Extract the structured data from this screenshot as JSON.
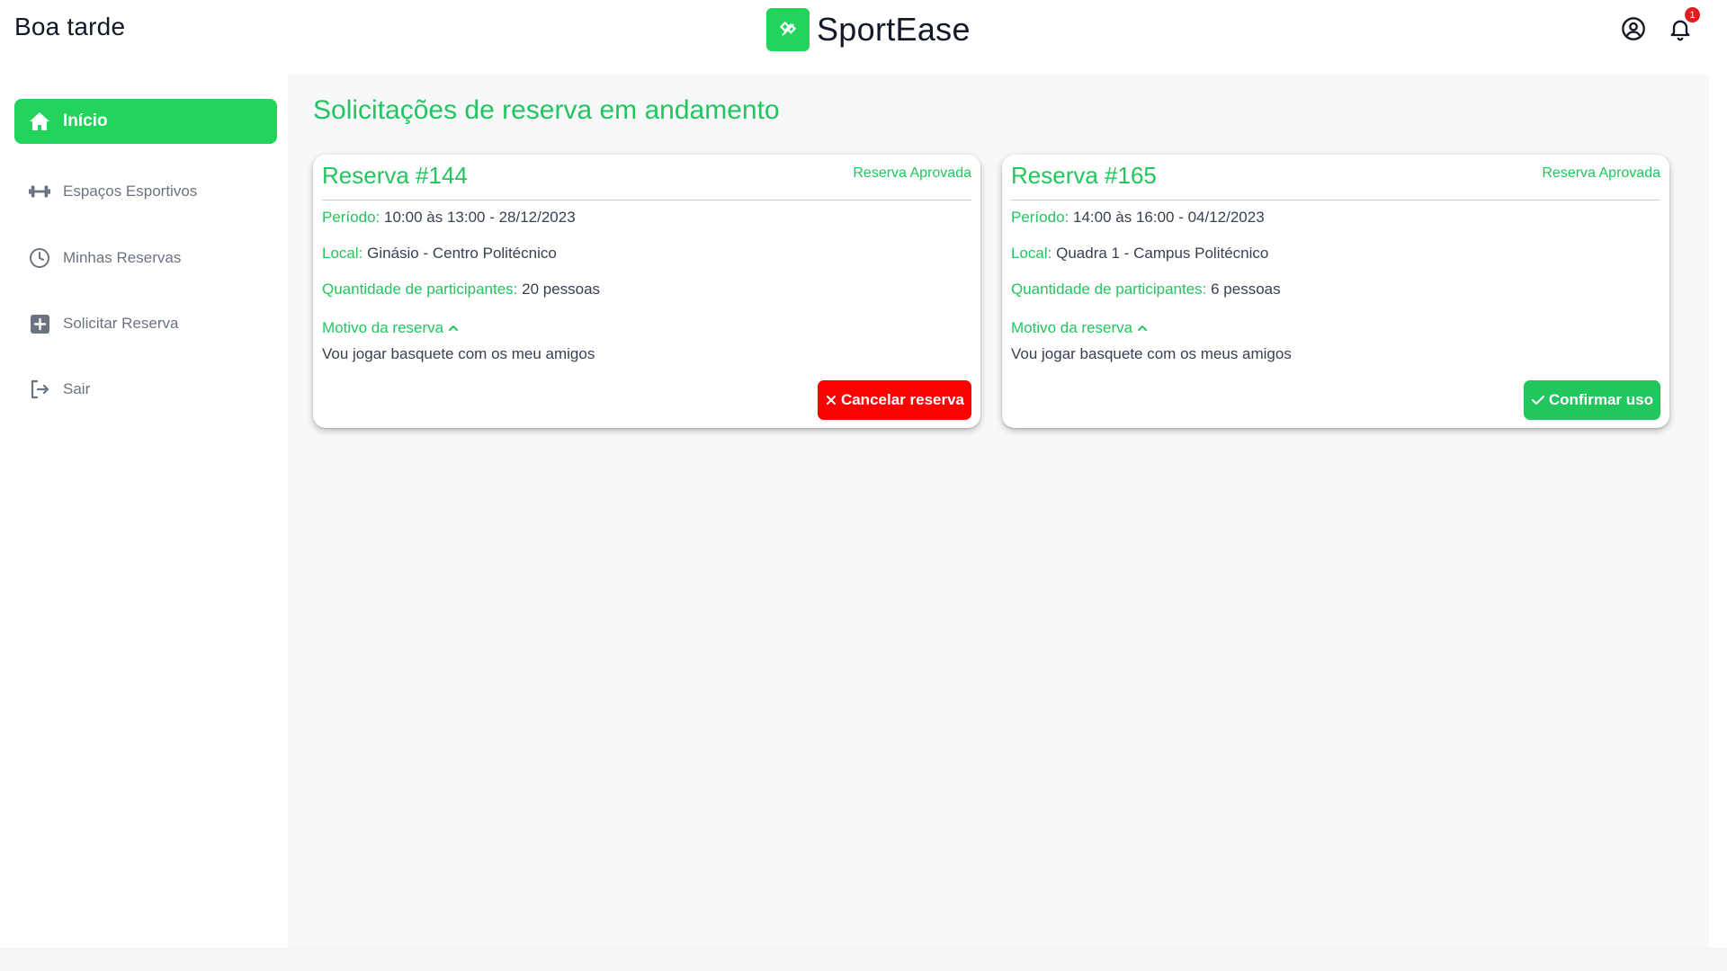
{
  "header": {
    "greeting": "Boa tarde",
    "brand_name": "SportEase",
    "notification_count": "1",
    "accent_color": "#22d45c"
  },
  "sidebar": {
    "items": [
      {
        "label": "Início",
        "icon": "home-icon",
        "active": true
      },
      {
        "label": "Espaços Esportivos",
        "icon": "dumbbell-icon",
        "active": false
      },
      {
        "label": "Minhas Reservas",
        "icon": "clock-icon",
        "active": false
      },
      {
        "label": "Solicitar Reserva",
        "icon": "plus-square-icon",
        "active": false
      },
      {
        "label": "Sair",
        "icon": "logout-icon",
        "active": false
      }
    ]
  },
  "main": {
    "title": "Solicitações de reserva em andamento",
    "cards": [
      {
        "title": "Reserva #144",
        "status": "Reserva Aprovada",
        "periodo_label": "Período:",
        "periodo": "10:00 às 13:00 - 28/12/2023",
        "local_label": "Local:",
        "local": "Ginásio - Centro Politécnico",
        "participantes_label": "Quantidade de participantes:",
        "participantes": "20 pessoas",
        "motivo_label": "Motivo da reserva",
        "motivo": "Vou jogar basquete com os meu amigos",
        "action_label": "Cancelar reserva",
        "action_color": "#ff0000"
      },
      {
        "title": "Reserva #165",
        "status": "Reserva Aprovada",
        "periodo_label": "Período:",
        "periodo": "14:00 às 16:00 - 04/12/2023",
        "local_label": "Local:",
        "local": "Quadra 1 - Campus Politécnico",
        "participantes_label": "Quantidade de participantes:",
        "participantes": "6 pessoas",
        "motivo_label": "Motivo da reserva",
        "motivo": "Vou jogar basquete com os meus amigos",
        "action_label": "Confirmar uso",
        "action_color": "#22c55e"
      }
    ]
  }
}
